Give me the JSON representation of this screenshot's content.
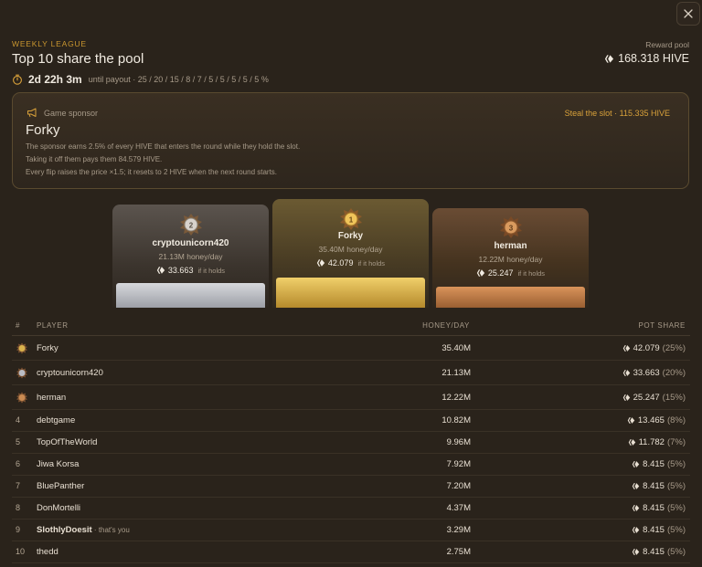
{
  "header": {
    "eyebrow": "WEEKLY LEAGUE",
    "title": "Top 10 share the pool",
    "countdown": "2d 22h 3m",
    "payout_text": "until payout · 25 / 20 / 15 / 8 / 7 / 5 / 5 / 5 / 5 / 5 %",
    "pool_label": "Reward pool",
    "pool_value": "168.318 HIVE"
  },
  "sponsor": {
    "label": "Game sponsor",
    "name": "Forky",
    "steal": "Steal the slot · 115.335 HIVE",
    "lines": [
      "The sponsor earns 2.5% of every HIVE that enters the round while they hold the slot.",
      "Taking it off them pays them 84.579 HIVE.",
      "Every flip raises the price ×1.5; it resets to 2 HIVE when the next round starts."
    ]
  },
  "podium": {
    "first": {
      "name": "Forky",
      "honey": "35.40M honey/day",
      "share": "42.079",
      "hold": "if it holds",
      "rank": "1"
    },
    "second": {
      "name": "cryptounicorn420",
      "honey": "21.13M honey/day",
      "share": "33.663",
      "hold": "if it holds",
      "rank": "2"
    },
    "third": {
      "name": "herman",
      "honey": "12.22M honey/day",
      "share": "25.247",
      "hold": "if it holds",
      "rank": "3"
    }
  },
  "table": {
    "headers": {
      "rank": "#",
      "player": "PLAYER",
      "honey": "HONEY/DAY",
      "share": "POT SHARE"
    },
    "rows": [
      {
        "rank": "",
        "player": "Forky",
        "honey": "35.40M",
        "share": "42.079",
        "pct": "(25%)",
        "tier": "gold"
      },
      {
        "rank": "",
        "player": "cryptounicorn420",
        "honey": "21.13M",
        "share": "33.663",
        "pct": "(20%)",
        "tier": "silver"
      },
      {
        "rank": "",
        "player": "herman",
        "honey": "12.22M",
        "share": "25.247",
        "pct": "(15%)",
        "tier": "bronze"
      },
      {
        "rank": "4",
        "player": "debtgame",
        "honey": "10.82M",
        "share": "13.465",
        "pct": "(8%)"
      },
      {
        "rank": "5",
        "player": "TopOfTheWorld",
        "honey": "9.96M",
        "share": "11.782",
        "pct": "(7%)"
      },
      {
        "rank": "6",
        "player": "Jiwa Korsa",
        "honey": "7.92M",
        "share": "8.415",
        "pct": "(5%)"
      },
      {
        "rank": "7",
        "player": "BluePanther",
        "honey": "7.20M",
        "share": "8.415",
        "pct": "(5%)"
      },
      {
        "rank": "8",
        "player": "DonMortelli",
        "honey": "4.37M",
        "share": "8.415",
        "pct": "(5%)"
      },
      {
        "rank": "9",
        "player": "SlothlyDoesit",
        "honey": "3.29M",
        "share": "8.415",
        "pct": "(5%)",
        "you": "· that's you"
      },
      {
        "rank": "10",
        "player": "thedd",
        "honey": "2.75M",
        "share": "8.415",
        "pct": "(5%)"
      }
    ]
  },
  "colors": {
    "accent": "#c9962f",
    "gold": "#d8b24c",
    "silver": "#b9bcc4",
    "bronze": "#c98a52",
    "background": "#2a231b"
  }
}
